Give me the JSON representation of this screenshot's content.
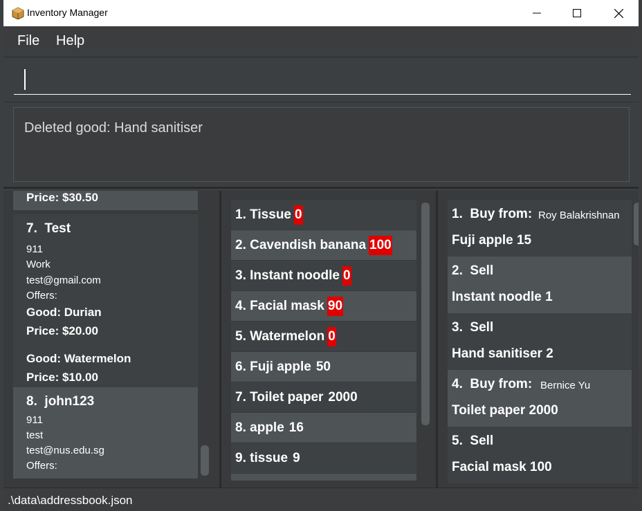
{
  "window": {
    "title": "Inventory Manager",
    "icon": "box-icon"
  },
  "menu": {
    "file": "File",
    "help": "Help"
  },
  "command": {
    "value": "",
    "placeholder": ""
  },
  "result": {
    "message": "Deleted good: Hand sanitiser"
  },
  "suppliers": {
    "top_partial": "Price: $30.50",
    "items": [
      {
        "index": "7.",
        "name": "Test",
        "phone": "911",
        "address": "Work",
        "email": "test@gmail.com",
        "offers_label": "Offers:",
        "offers": [
          {
            "good": "Good: Durian",
            "price": "Price: $20.00"
          },
          {
            "good": "Good: Watermelon",
            "price": "Price: $10.00"
          }
        ]
      },
      {
        "index": "8.",
        "name": "john123",
        "phone": "911",
        "address": "test",
        "email": "test@nus.edu.sg",
        "offers_label": "Offers:"
      }
    ]
  },
  "goods": [
    {
      "index": "1.",
      "name": "Tissue",
      "qty": "0",
      "low": true
    },
    {
      "index": "2.",
      "name": "Cavendish banana",
      "qty": "100",
      "low": true
    },
    {
      "index": "3.",
      "name": "Instant noodle",
      "qty": "0",
      "low": true
    },
    {
      "index": "4.",
      "name": "Facial mask",
      "qty": "90",
      "low": true
    },
    {
      "index": "5.",
      "name": "Watermelon",
      "qty": "0",
      "low": true
    },
    {
      "index": "6.",
      "name": "Fuji apple",
      "qty": "50",
      "low": false
    },
    {
      "index": "7.",
      "name": "Toilet paper",
      "qty": "2000",
      "low": false
    },
    {
      "index": "8.",
      "name": "apple",
      "qty": "16",
      "low": false
    },
    {
      "index": "9.",
      "name": "tissue",
      "qty": "9",
      "low": false
    }
  ],
  "transactions": [
    {
      "index": "1.",
      "type": "Buy from:",
      "party": "Roy Balakrishnan",
      "detail": "Fuji apple 15"
    },
    {
      "index": "2.",
      "type": "Sell",
      "party": "",
      "detail": "Instant noodle 1"
    },
    {
      "index": "3.",
      "type": "Sell",
      "party": "",
      "detail": "Hand sanitiser 2"
    },
    {
      "index": "4.",
      "type": "Buy from:",
      "party": "Bernice Yu",
      "detail": "Toilet paper 2000"
    },
    {
      "index": "5.",
      "type": "Sell",
      "party": "",
      "detail": "Facial mask 100"
    }
  ],
  "status": {
    "path": ".\\data\\addressbook.json"
  },
  "colors": {
    "background": "#3c3f41",
    "card_light": "#4e5356",
    "card_dark": "#3e4143",
    "low_stock": "#e00000"
  }
}
